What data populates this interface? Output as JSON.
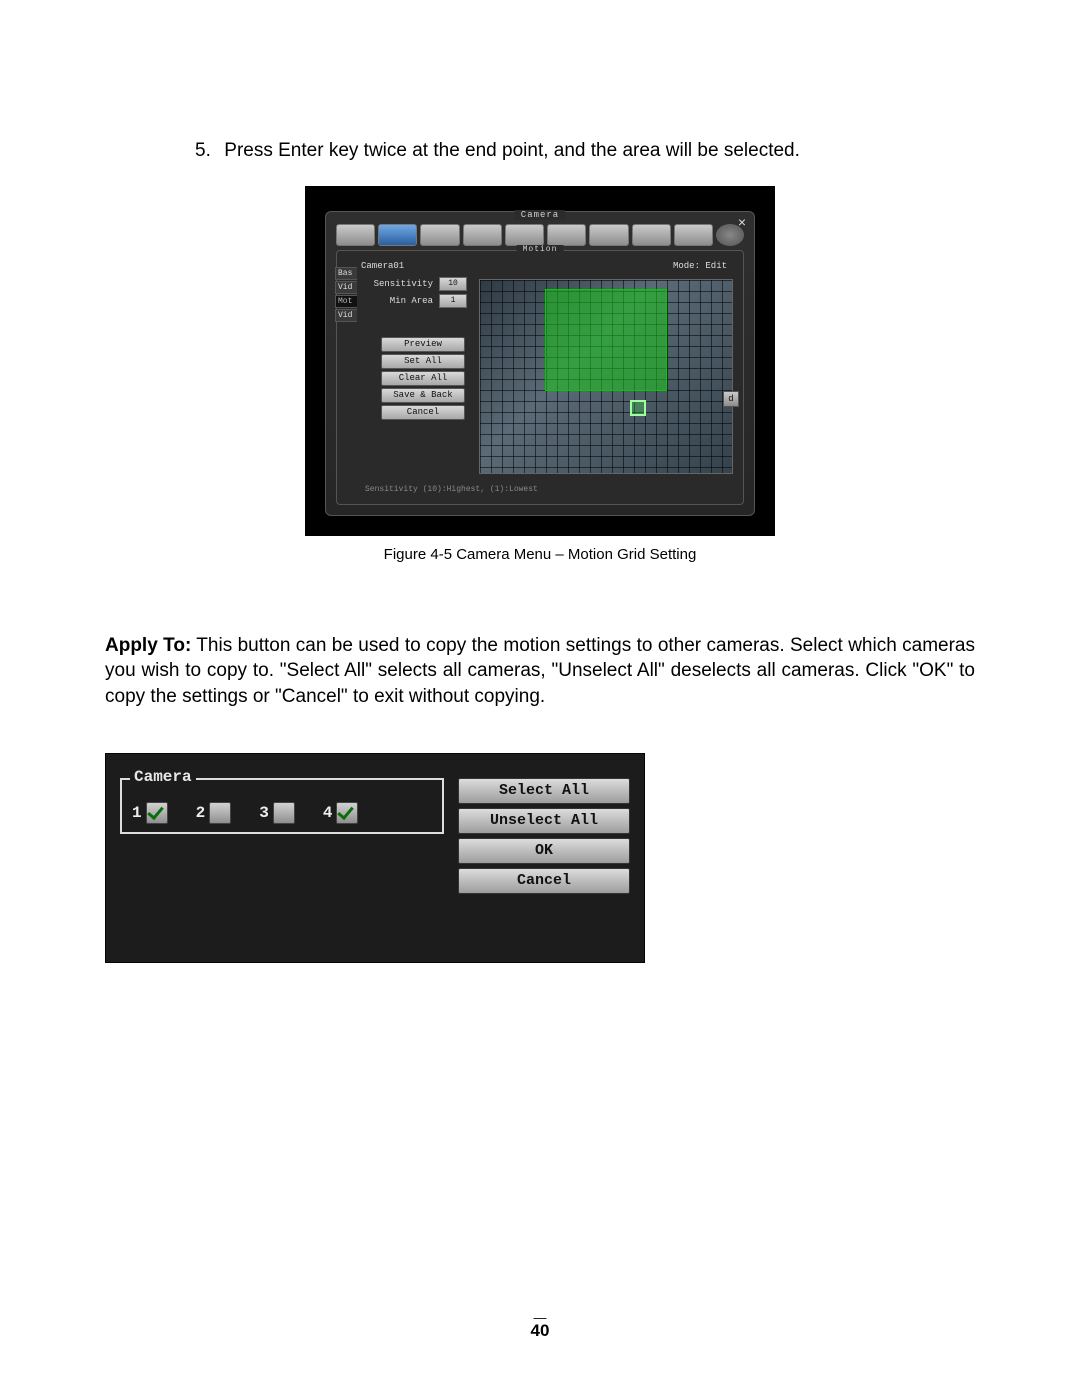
{
  "instruction": {
    "num": "5.",
    "text": "Press Enter key twice at the end point, and the area will be selected."
  },
  "fig1": {
    "windowTitle": "Camera",
    "panelTitle": "Motion",
    "sideTabs": [
      "Bas",
      "Vid",
      "Mot",
      "Vid"
    ],
    "topRow": {
      "camera": "Camera01",
      "modeLabel": "Mode:",
      "modeValue": "Edit"
    },
    "sensitivity": {
      "label": "Sensitivity",
      "value": "10"
    },
    "minArea": {
      "label": "Min Area",
      "value": "1"
    },
    "buttons": {
      "preview": "Preview",
      "setAll": "Set All",
      "clearAll": "Clear All",
      "saveBack": "Save & Back",
      "cancel": "Cancel"
    },
    "chip": "d",
    "hint": "Sensitivity (10):Highest, (1):Lowest",
    "caption": "Figure 4-5 Camera Menu – Motion Grid Setting"
  },
  "applyPara": {
    "lead": "Apply To:",
    "text": " This button can be used to copy the motion settings to other cameras. Select which cameras you wish to copy to. \"Select All\" selects all cameras, \"Unselect All\" deselects all cameras. Click \"OK\" to copy the settings or \"Cancel\" to exit without copying."
  },
  "fig2": {
    "legend": "Camera",
    "items": [
      {
        "label": "1",
        "checked": true
      },
      {
        "label": "2",
        "checked": false
      },
      {
        "label": "3",
        "checked": false
      },
      {
        "label": "4",
        "checked": true
      }
    ],
    "buttons": {
      "selectAll": "Select All",
      "unselectAll": "Unselect All",
      "ok": "OK",
      "cancel": "Cancel"
    }
  },
  "pageNumber": "40"
}
